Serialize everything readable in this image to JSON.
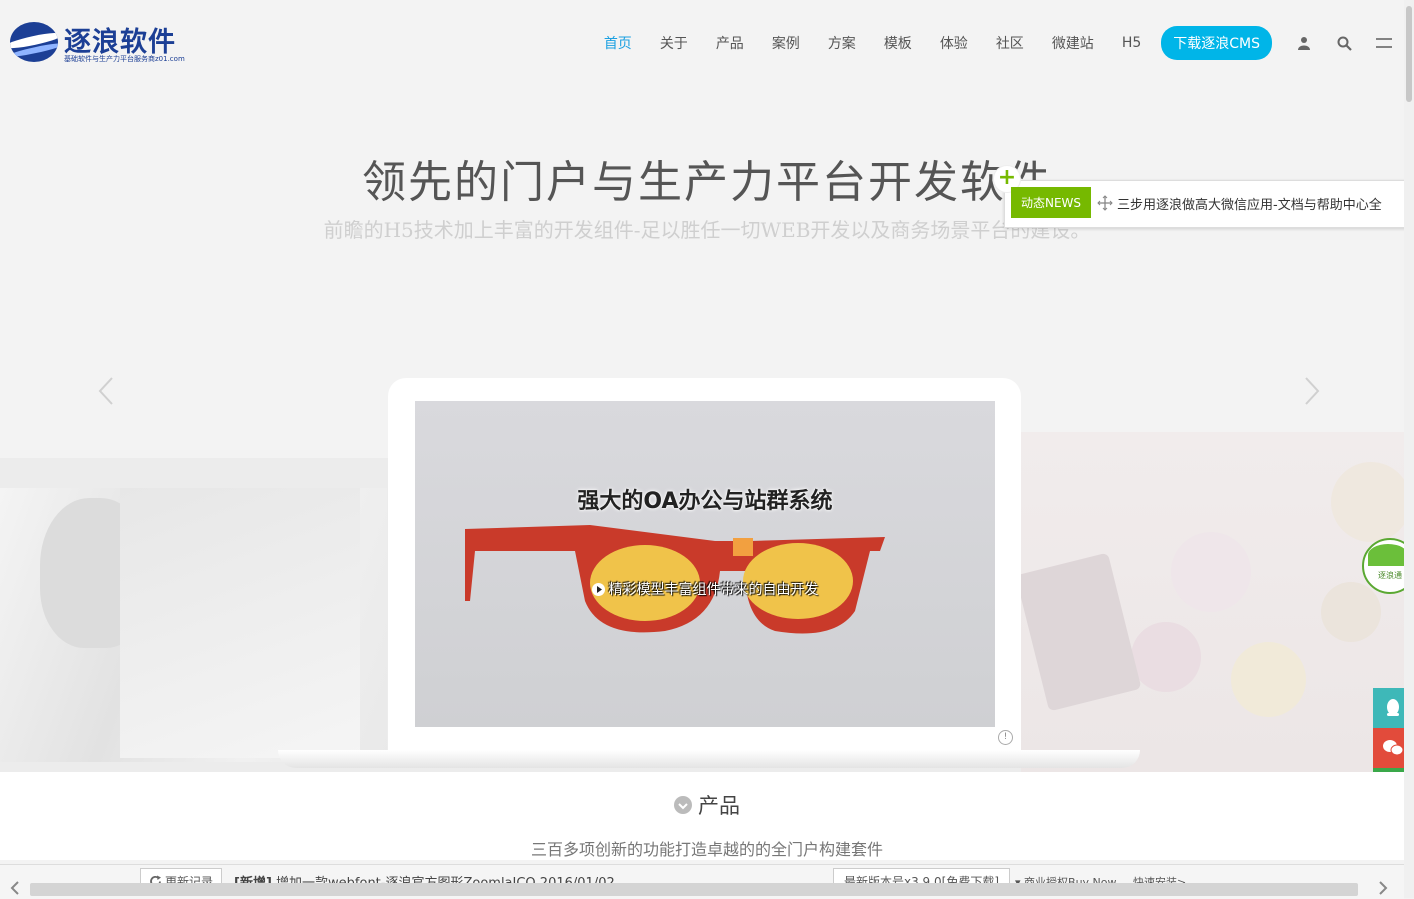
{
  "header": {
    "logo_text": "逐浪软件",
    "logo_sub": "基础软件与生产力平台服务商z01.com",
    "nav": [
      {
        "label": "首页",
        "active": true
      },
      {
        "label": "关于"
      },
      {
        "label": "产品"
      },
      {
        "label": "案例"
      },
      {
        "label": "方案"
      },
      {
        "label": "模板"
      },
      {
        "label": "体验"
      },
      {
        "label": "社区"
      },
      {
        "label": "微建站"
      },
      {
        "label": "H5"
      }
    ],
    "download_label": "下载逐浪CMS",
    "icons": [
      "user-icon",
      "search-icon",
      "menu-icon"
    ]
  },
  "hero": {
    "title": "领先的门户与生产力平台开发软件",
    "subtitle": "前瞻的H5技术加上丰富的开发组件-足以胜任一切WEB开发以及商务场景平台的建设。",
    "prev_icon": "chevron-left-icon",
    "next_icon": "chevron-right-icon"
  },
  "slide": {
    "title": "强大的OA办公与站群系统",
    "subtitle": "精彩模型丰富组件带来的自由开发"
  },
  "news": {
    "badge": "动态NEWS",
    "plus": "+",
    "text": "三步用逐浪做高大微信应用-文档与帮助中心全"
  },
  "side": {
    "bubble_label": "逐浪通",
    "buttons": [
      "qq-icon",
      "wechat-icon",
      "cloud-download-icon",
      "back-to-top-icon"
    ],
    "colors": [
      "#3eb8b8",
      "#e24b3b",
      "#3aa84a",
      "#555555"
    ]
  },
  "products": {
    "heading": "产品",
    "subheading": "三百多项创新的功能打造卓越的的全门户构建套件"
  },
  "footer": {
    "updates_label": "更新记录",
    "news_tag": "[新增]",
    "news_text": "增加一款webfont-逐浪官方图形ZoomlaICO 2016/01/02",
    "version_label": "最新版本号x3.9.0[免费下载]",
    "buy_label": "商业授权Buy Now",
    "install_label": "快速安装>"
  },
  "colors": {
    "brand": "#1c3f95",
    "accent": "#00b5e8",
    "news_green": "#76b900"
  }
}
